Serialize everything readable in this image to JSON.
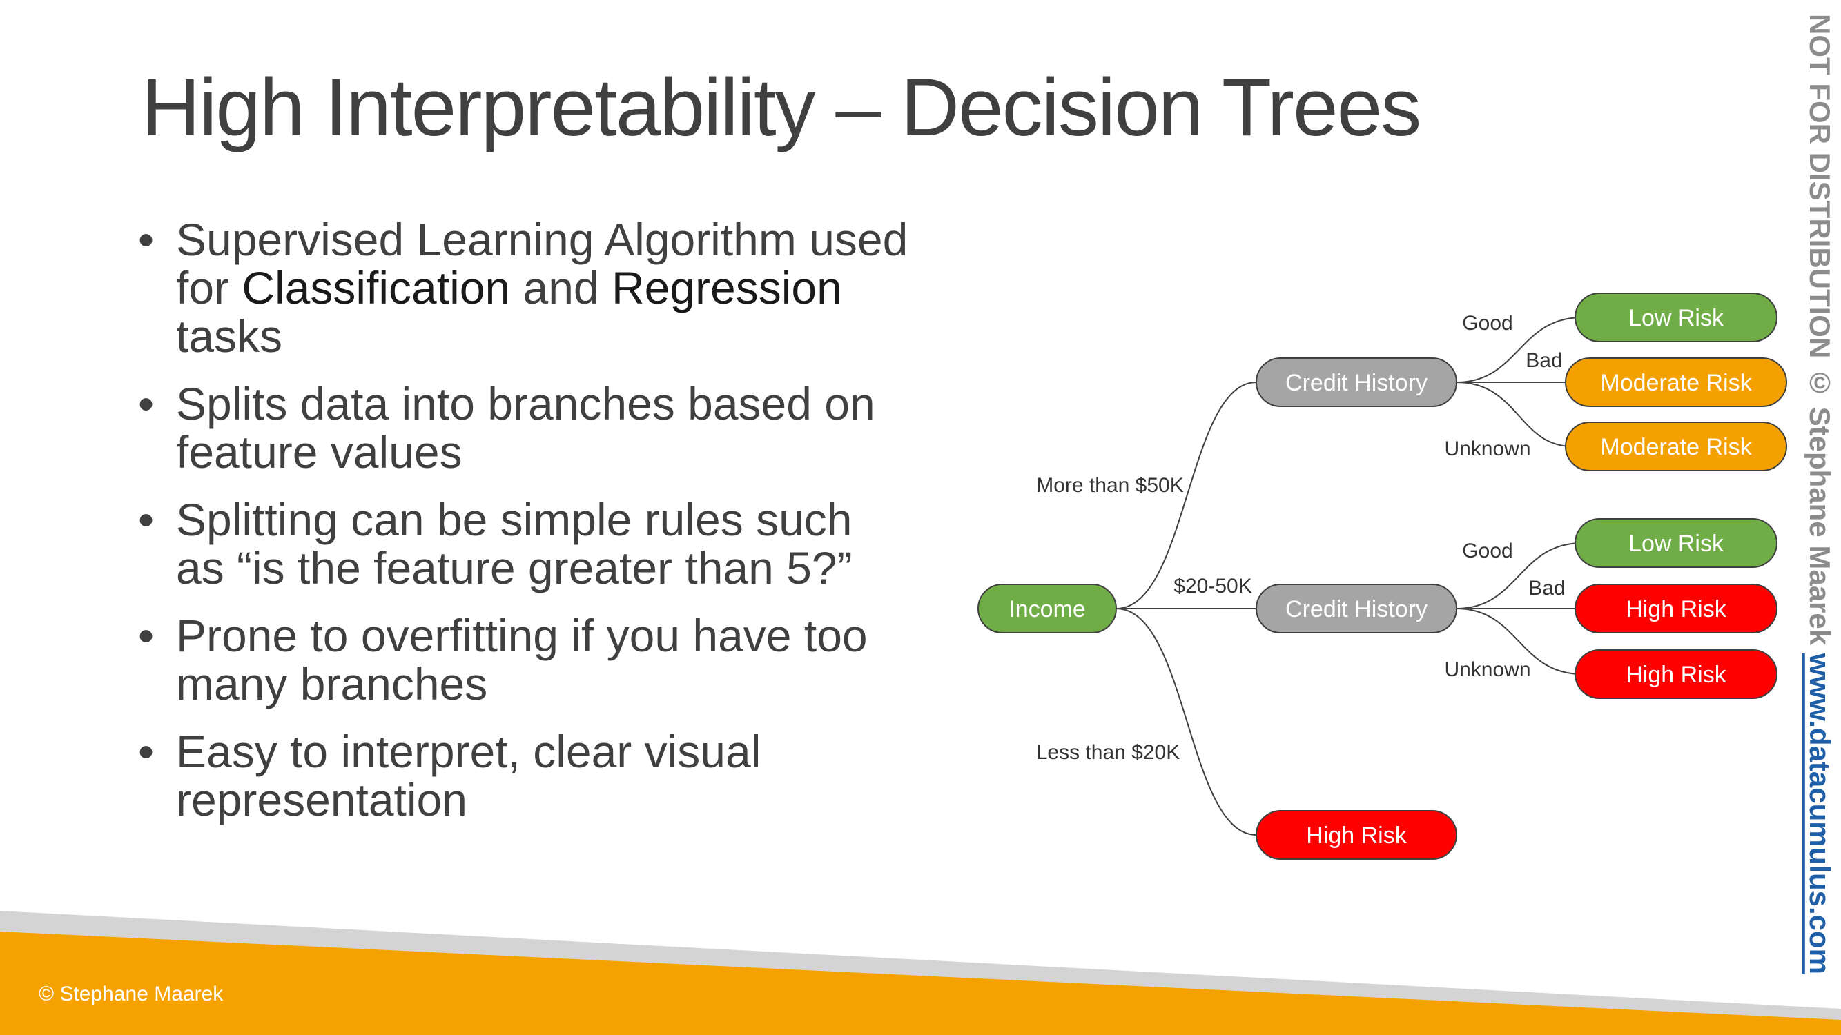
{
  "slide": {
    "title": "High Interpretability – Decision Trees",
    "bullets": [
      {
        "pre": "Supervised Learning Algorithm used for ",
        "b1": "Classification",
        "mid": " and ",
        "b2": "Regression",
        "post": " tasks"
      },
      {
        "text": "Splits data into branches based on feature values"
      },
      {
        "text": "Splitting can be simple rules such as “is the feature greater than 5?”"
      },
      {
        "text": "Prone to overfitting if you have too many branches"
      },
      {
        "text": "Easy to interpret, clear visual representation"
      }
    ],
    "footer": "© Stephane Maarek",
    "watermark": {
      "text": "NOT FOR DISTRIBUTION © Stephane Maarek",
      "site": "www.datacumulus.com"
    }
  },
  "colors": {
    "green": "#70ad47",
    "gray": "#a5a5a5",
    "orange": "#f4a000",
    "red": "#ff0000",
    "footer_orange": "#f5a200"
  },
  "tree": {
    "root": "Income",
    "branches": [
      {
        "label": "More than $50K",
        "node": "Credit History",
        "leaves": [
          {
            "edge": "Good",
            "label": "Low Risk",
            "color": "green"
          },
          {
            "edge": "Bad",
            "label": "Moderate Risk",
            "color": "orange"
          },
          {
            "edge": "Unknown",
            "label": "Moderate Risk",
            "color": "orange"
          }
        ]
      },
      {
        "label": "$20-50K",
        "node": "Credit History",
        "leaves": [
          {
            "edge": "Good",
            "label": "Low Risk",
            "color": "green"
          },
          {
            "edge": "Bad",
            "label": "High Risk",
            "color": "red"
          },
          {
            "edge": "Unknown",
            "label": "High Risk",
            "color": "red"
          }
        ]
      },
      {
        "label": "Less than $20K",
        "node": "High Risk",
        "color": "red"
      }
    ]
  }
}
